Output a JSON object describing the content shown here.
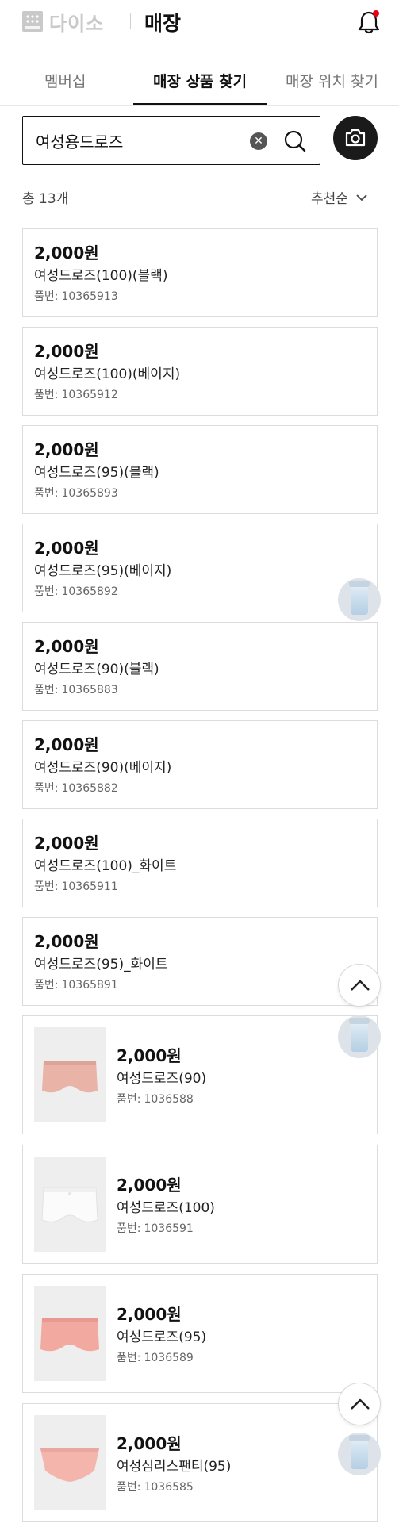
{
  "header": {
    "logo_text": "다이소",
    "title": "매장",
    "accent_color": "#e60012"
  },
  "tabs": [
    {
      "label": "멤버십",
      "active": false
    },
    {
      "label": "매장 상품 찾기",
      "active": true
    },
    {
      "label": "매장 위치 찾기",
      "active": false
    }
  ],
  "search": {
    "value": "여성용드로즈",
    "clear_icon": "clear-icon",
    "search_icon": "search-icon",
    "camera_icon": "camera-icon"
  },
  "results": {
    "count": "총 13개",
    "sort": "추천순"
  },
  "code_label": "품번:",
  "products": [
    {
      "price": "2,000원",
      "name": "여성드로즈(100)(블랙)",
      "code": "10365913",
      "image": false
    },
    {
      "price": "2,000원",
      "name": "여성드로즈(100)(베이지)",
      "code": "10365912",
      "image": false
    },
    {
      "price": "2,000원",
      "name": "여성드로즈(95)(블랙)",
      "code": "10365893",
      "image": false
    },
    {
      "price": "2,000원",
      "name": "여성드로즈(95)(베이지)",
      "code": "10365892",
      "image": false
    },
    {
      "price": "2,000원",
      "name": "여성드로즈(90)(블랙)",
      "code": "10365883",
      "image": false
    },
    {
      "price": "2,000원",
      "name": "여성드로즈(90)(베이지)",
      "code": "10365882",
      "image": false
    },
    {
      "price": "2,000원",
      "name": "여성드로즈(100)_화이트",
      "code": "10365911",
      "image": false
    },
    {
      "price": "2,000원",
      "name": "여성드로즈(95)_화이트",
      "code": "10365891",
      "image": false
    },
    {
      "price": "2,000원",
      "name": "여성드로즈(90)",
      "code": "1036588",
      "image": true,
      "image_color": "#e9b3a8"
    },
    {
      "price": "2,000원",
      "name": "여성드로즈(100)",
      "code": "1036591",
      "image": true,
      "image_color": "#fafafa"
    },
    {
      "price": "2,000원",
      "name": "여성드로즈(95)",
      "code": "1036589",
      "image": true,
      "image_color": "#f2a9a0"
    },
    {
      "price": "2,000원",
      "name": "여성심리스팬티(95)",
      "code": "1036585",
      "image": true,
      "image_color": "#f4b5ad"
    }
  ]
}
